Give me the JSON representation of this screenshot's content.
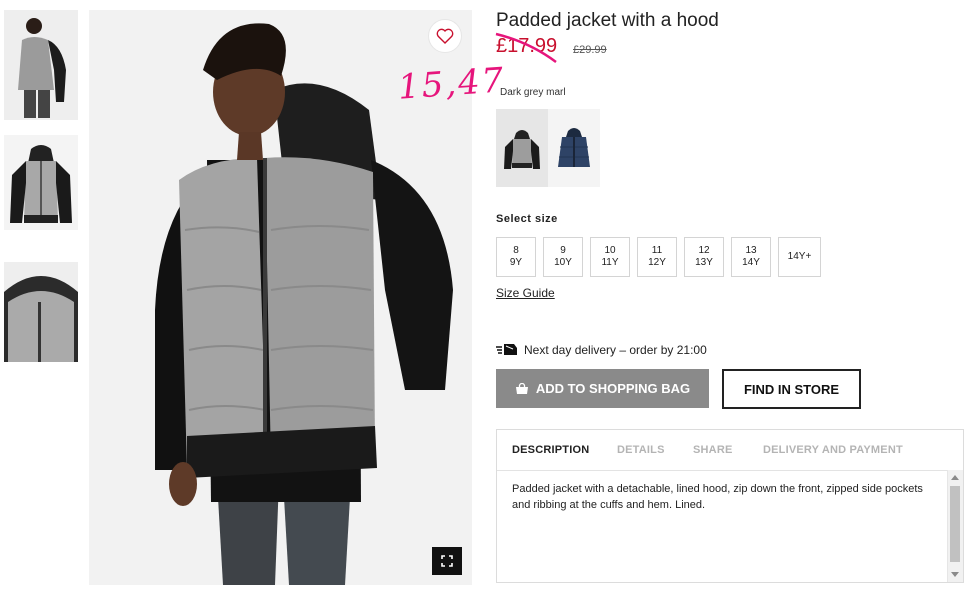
{
  "product": {
    "title": "Padded jacket with a hood",
    "sale_price": "£17.99",
    "old_price": "£29.99",
    "annotation": "15,47",
    "color_name": "Dark grey marl"
  },
  "swatches": [
    {
      "name": "Dark grey marl",
      "selected": true
    },
    {
      "name": "Dark blue",
      "selected": false
    }
  ],
  "sizes": {
    "label": "Select size",
    "options": [
      {
        "line1": "8",
        "line2": "9Y"
      },
      {
        "line1": "9",
        "line2": "10Y"
      },
      {
        "line1": "10",
        "line2": "11Y"
      },
      {
        "line1": "11",
        "line2": "12Y"
      },
      {
        "line1": "12",
        "line2": "13Y"
      },
      {
        "line1": "13",
        "line2": "14Y"
      },
      {
        "line1": "14Y+",
        "line2": ""
      }
    ],
    "guide": "Size Guide"
  },
  "delivery": {
    "text": "Next day delivery – order by 21:00"
  },
  "actions": {
    "add_to_bag": "ADD TO SHOPPING BAG",
    "find_in_store": "FIND IN STORE"
  },
  "info": {
    "tabs": [
      "DESCRIPTION",
      "DETAILS",
      "SHARE",
      "DELIVERY AND PAYMENT"
    ],
    "active_tab": 0,
    "description": "Padded jacket with a detachable, lined hood, zip down the front, zipped side pockets and ribbing at the cuffs and hem. Lined."
  },
  "icons": {
    "favourite": "heart-icon",
    "expand": "fullscreen-icon",
    "delivery": "delivery-truck-icon",
    "bag": "shopping-bag-icon"
  },
  "colors": {
    "sale": "#c8102e",
    "annotation": "#e6157c",
    "button_grey": "#8a8a8a"
  }
}
